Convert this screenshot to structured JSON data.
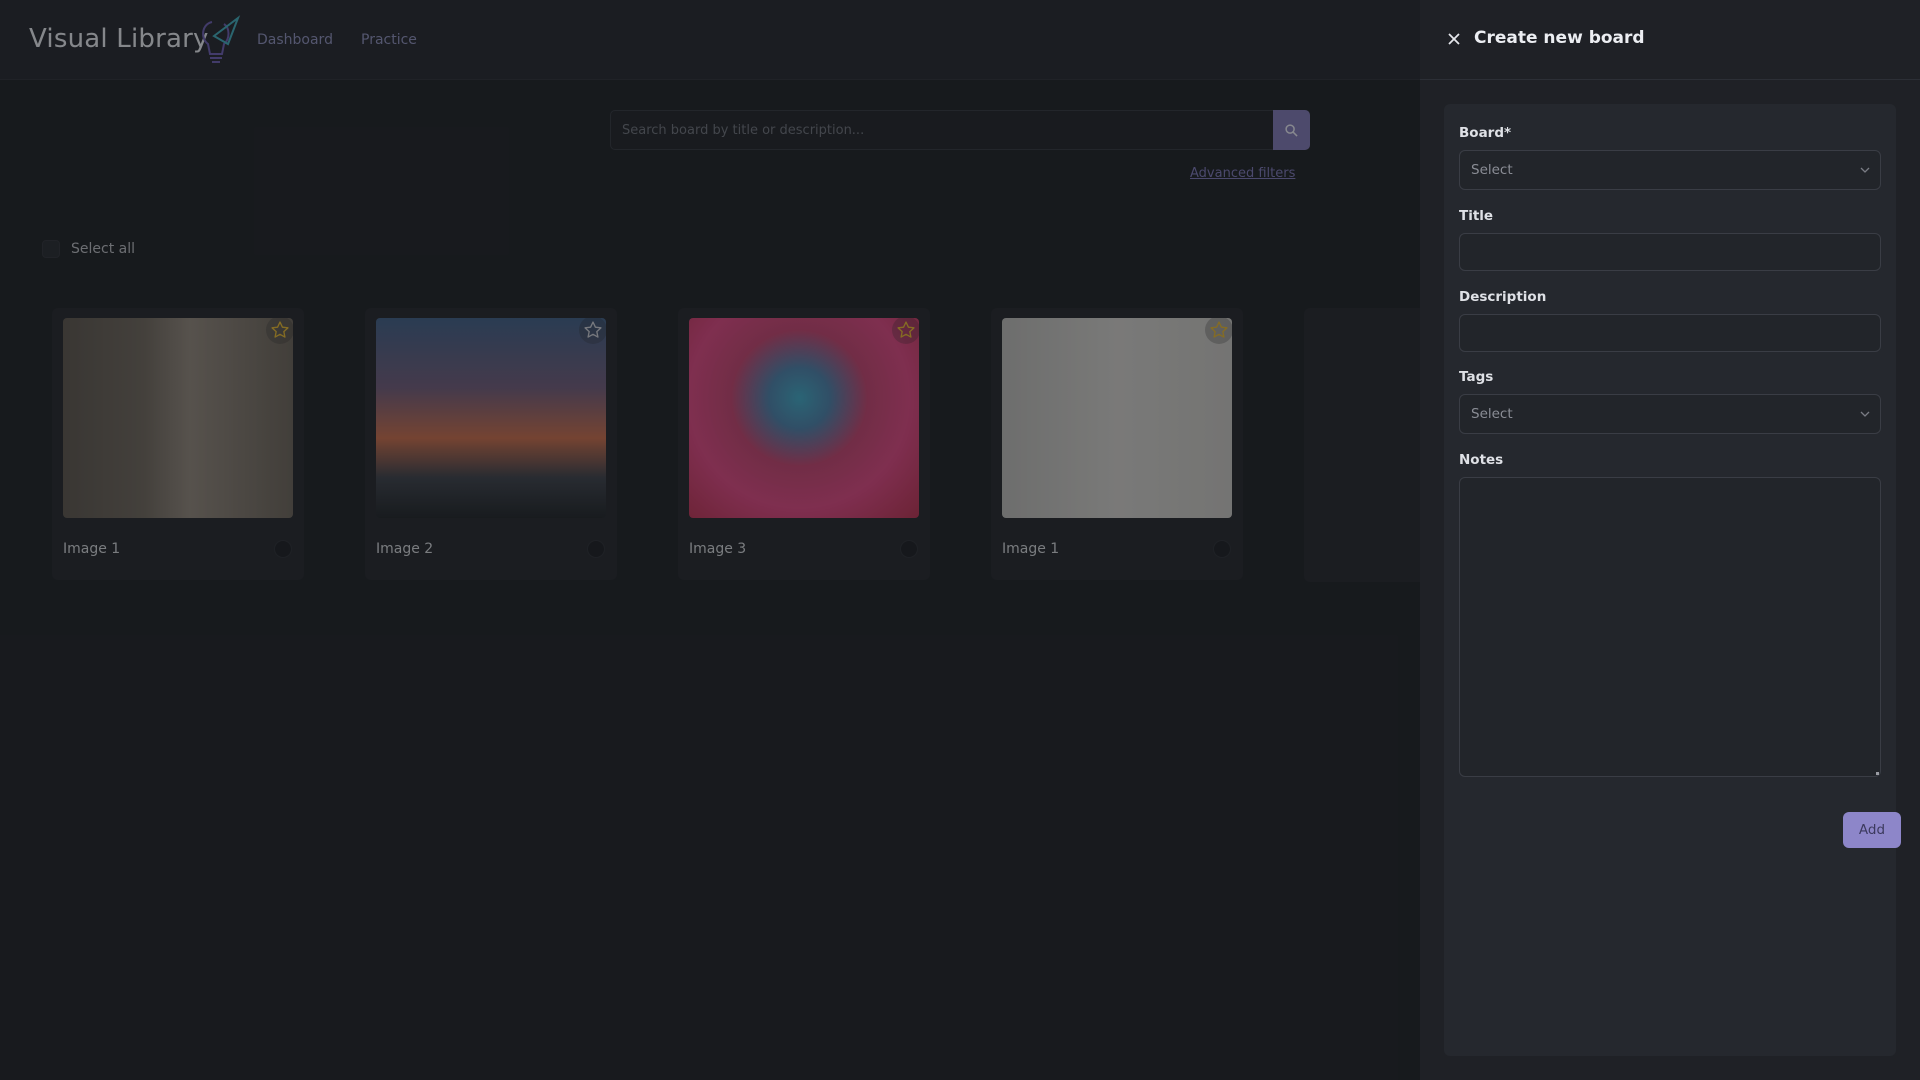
{
  "app": {
    "brand": "Visual Library",
    "nav": [
      {
        "label": "Dashboard"
      },
      {
        "label": "Practice"
      }
    ],
    "accent_color": "#7f77b3"
  },
  "search": {
    "placeholder": "Search board by title or description...",
    "value": "",
    "advanced_filters_label": "Advanced filters"
  },
  "selection": {
    "select_all_label": "Select all"
  },
  "cards": [
    {
      "title": "Image 1",
      "icon": "star-icon"
    },
    {
      "title": "Image 2",
      "icon": "star-icon"
    },
    {
      "title": "Image 3",
      "icon": "star-icon"
    },
    {
      "title": "Image 1",
      "icon": "star-icon"
    }
  ],
  "drawer": {
    "title": "Create new board",
    "close_icon": "close-icon",
    "fields": {
      "board": {
        "label": "Board*",
        "placeholder": "Select"
      },
      "title": {
        "label": "Title",
        "value": ""
      },
      "description": {
        "label": "Description",
        "value": ""
      },
      "tags": {
        "label": "Tags",
        "placeholder": "Select"
      },
      "notes": {
        "label": "Notes",
        "value": ""
      }
    },
    "add_button_label": "Add"
  }
}
